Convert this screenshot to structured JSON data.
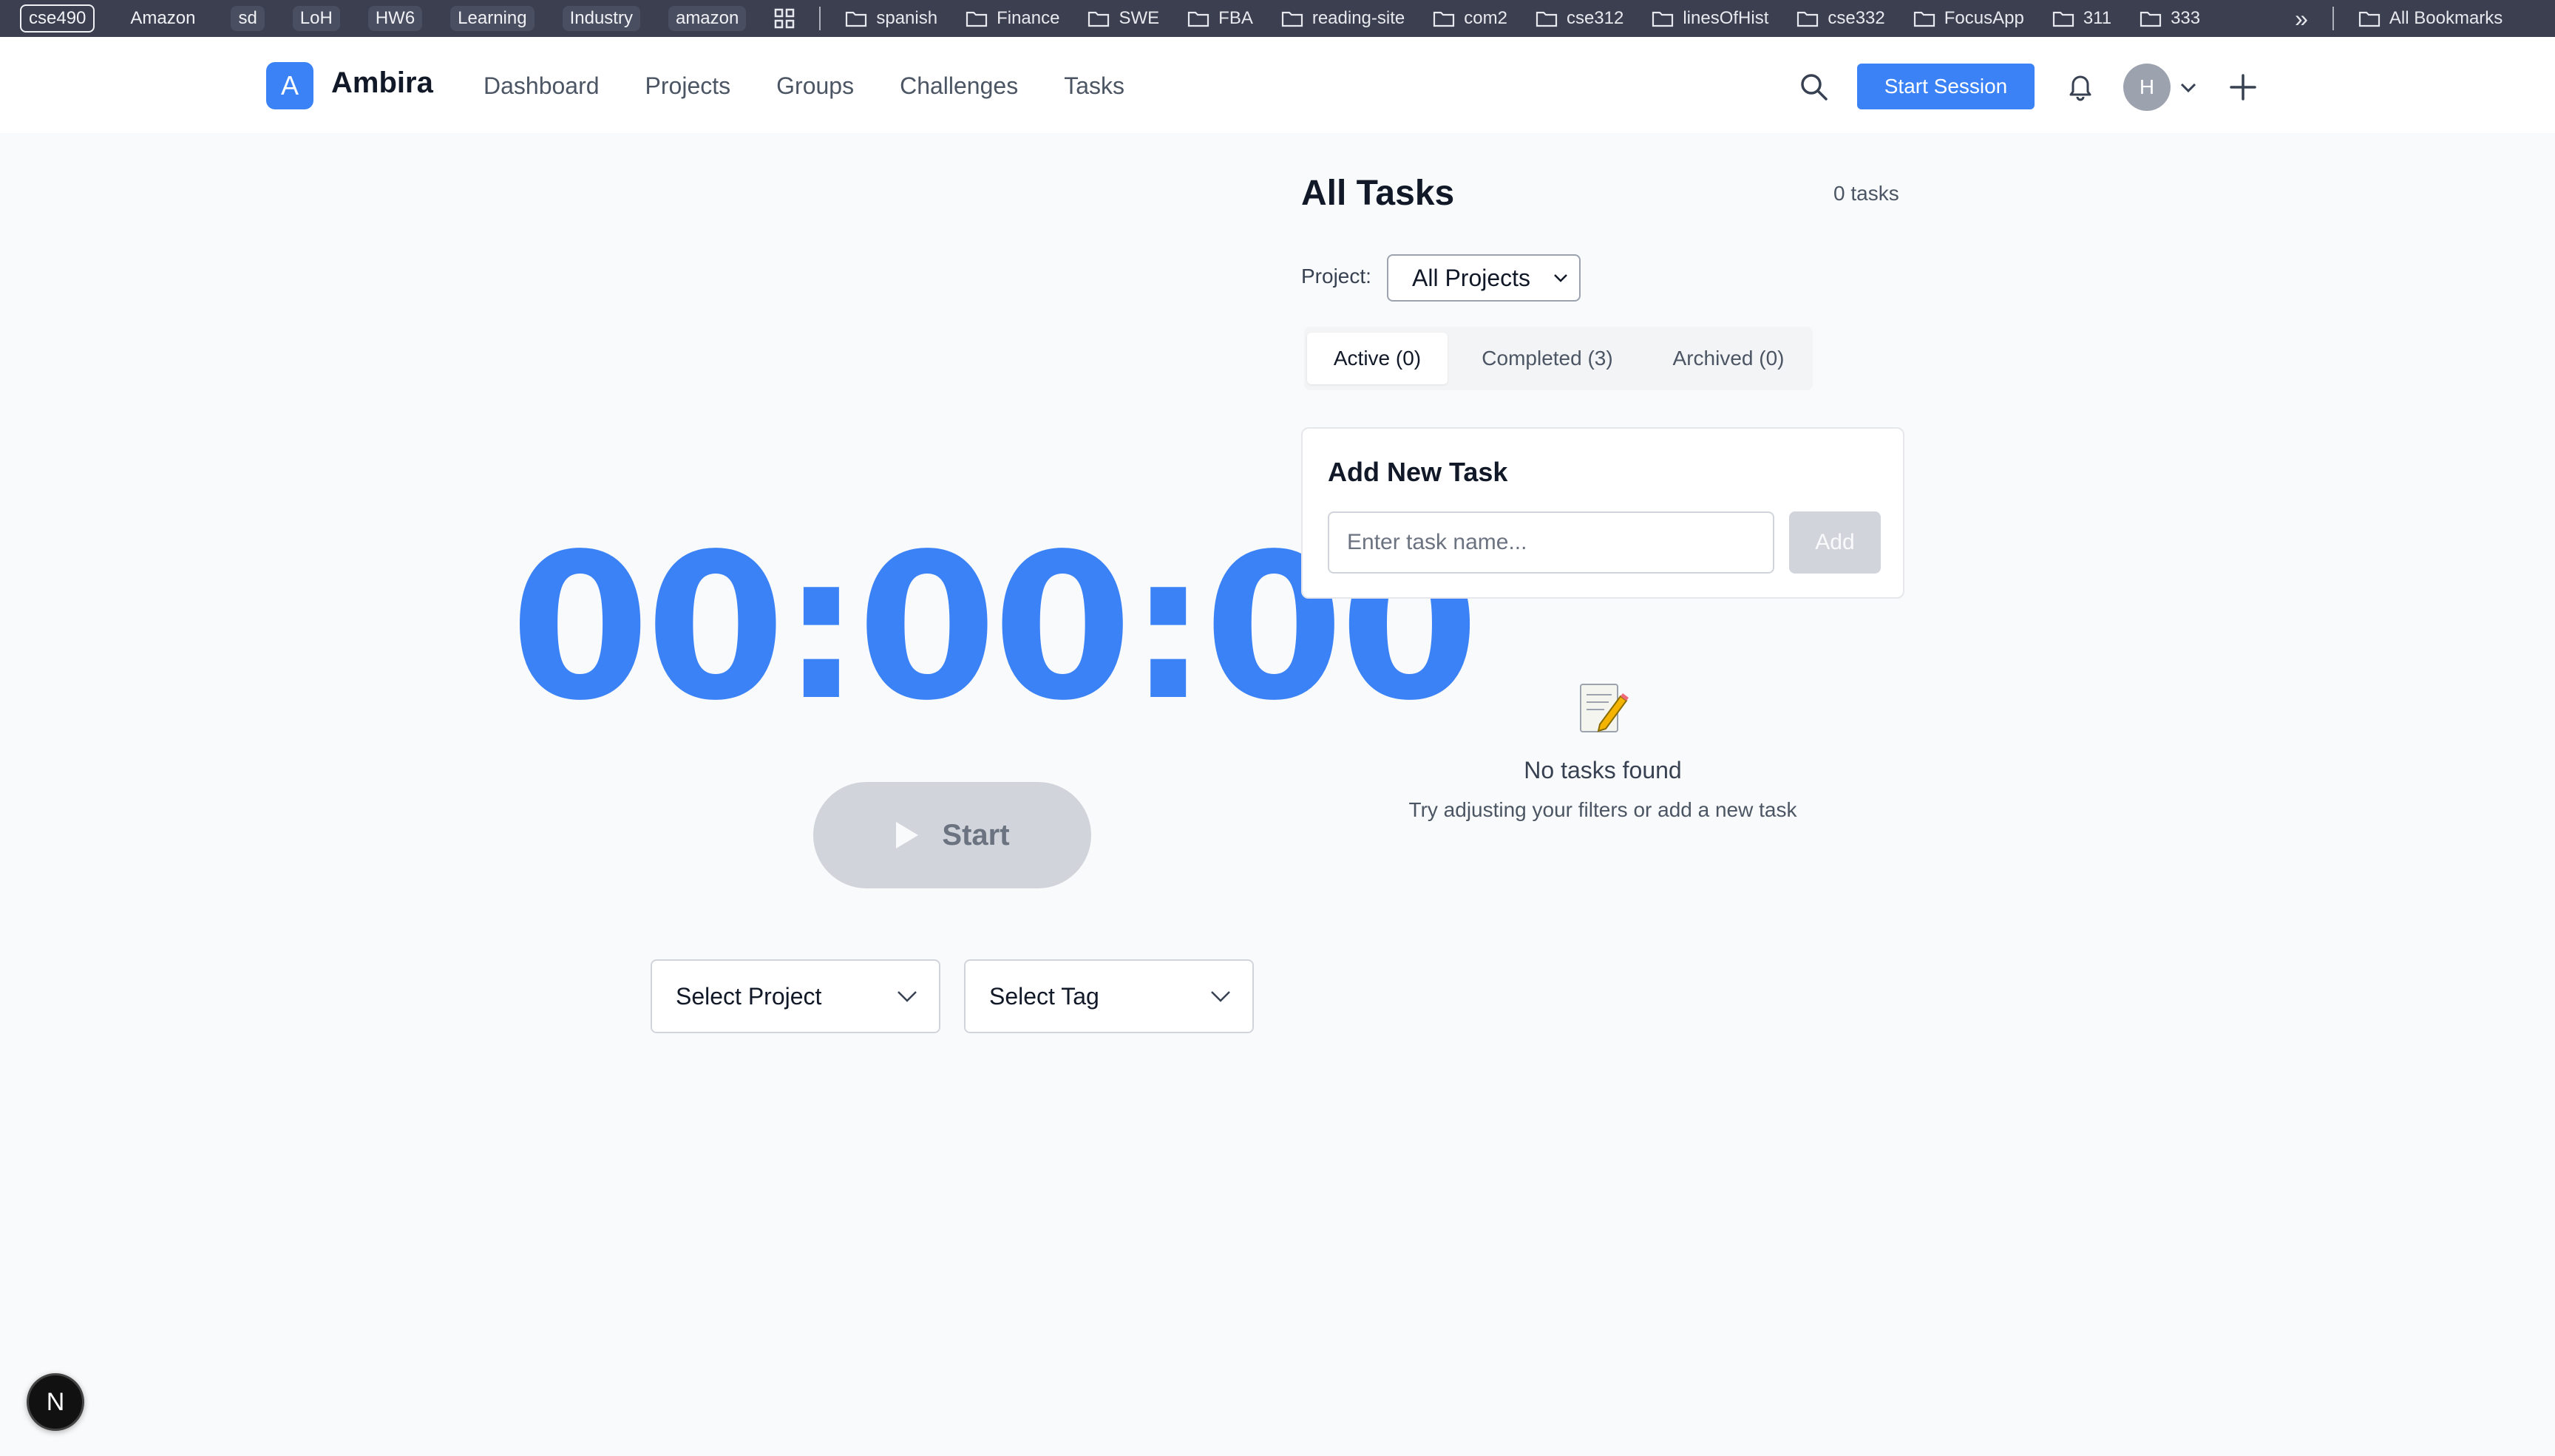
{
  "bookmarks": {
    "tags": [
      "cse490",
      "Amazon",
      "sd",
      "LoH",
      "HW6",
      "Learning",
      "Industry",
      "amazon"
    ],
    "folders": [
      "spanish",
      "Finance",
      "SWE",
      "FBA",
      "reading-site",
      "com2",
      "cse312",
      "linesOfHist",
      "cse332",
      "FocusApp",
      "311",
      "333"
    ],
    "overflow": "»",
    "all_bookmarks": "All Bookmarks"
  },
  "header": {
    "logo_letter": "A",
    "app_name": "Ambira",
    "nav": [
      "Dashboard",
      "Projects",
      "Groups",
      "Challenges",
      "Tasks"
    ],
    "start_session": "Start Session",
    "avatar_initial": "H"
  },
  "timer": {
    "display": "00:00:00",
    "start_label": "Start",
    "select_project": "Select Project",
    "select_tag": "Select Tag"
  },
  "tasks": {
    "title": "All Tasks",
    "count_label": "0 tasks",
    "project_label": "Project:",
    "project_value": "All Projects",
    "tabs": [
      "Active (0)",
      "Completed (3)",
      "Archived (0)"
    ],
    "add_title": "Add New Task",
    "input_placeholder": "Enter task name...",
    "add_button": "Add",
    "empty_title": "No tasks found",
    "empty_subtitle": "Try adjusting your filters or add a new task"
  },
  "dev_badge": "N",
  "colors": {
    "accent": "#3b82f6",
    "bookmarks_bar": "#3b3f50",
    "page_bg": "#f9fafb"
  }
}
